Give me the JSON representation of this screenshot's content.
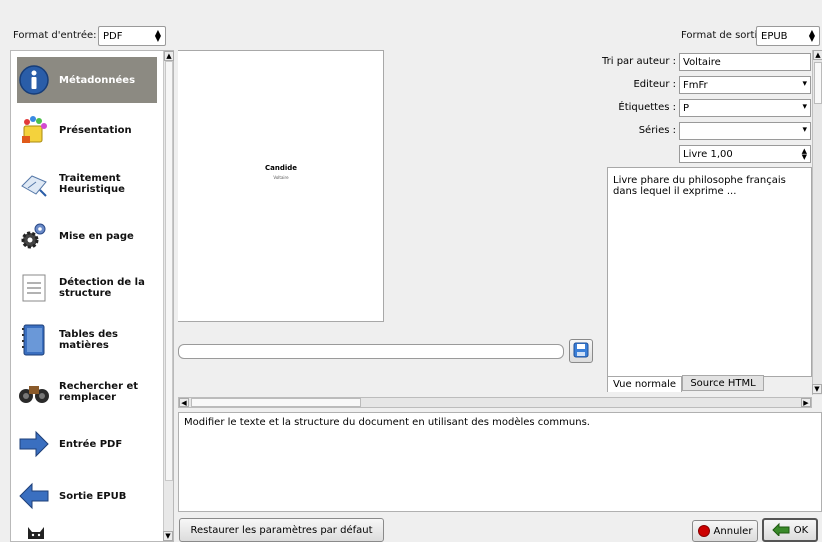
{
  "input_format": {
    "label": "Format d'entrée:",
    "value": "PDF"
  },
  "output_format": {
    "label": "Format de sortie:",
    "value": "EPUB"
  },
  "sidebar": {
    "items": [
      {
        "label": "Métadonnées",
        "icon": "info-icon",
        "selected": true
      },
      {
        "label": "Présentation",
        "icon": "palette-icon"
      },
      {
        "label": "Traitement Heuristique",
        "icon": "heuristics-icon"
      },
      {
        "label": "Mise en page",
        "icon": "gears-icon"
      },
      {
        "label": "Détection de la structure",
        "icon": "document-structure-icon"
      },
      {
        "label": "Tables des matières",
        "icon": "toc-book-icon"
      },
      {
        "label": "Rechercher et remplacer",
        "icon": "binoculars-icon"
      },
      {
        "label": "Entrée PDF",
        "icon": "arrow-right-icon"
      },
      {
        "label": "Sortie EPUB",
        "icon": "arrow-left-icon"
      }
    ]
  },
  "preview": {
    "title": "Candide",
    "author": "Voltaire"
  },
  "metadata": {
    "author_sort_label": "Tri par auteur :",
    "author_sort_value": "Voltaire",
    "publisher_label": "Editeur :",
    "publisher_value": "FmFr",
    "tags_label": "Étiquettes :",
    "tags_value": "P",
    "series_label": "Séries :",
    "series_value": "",
    "series_index": "Livre 1,00",
    "comments": "Livre phare du philosophe français dans lequel il exprime ..."
  },
  "comment_tabs": {
    "normal": "Vue normale",
    "html": "Source HTML"
  },
  "description": "Modifier le texte et la structure du document en utilisant des modèles communs.",
  "buttons": {
    "restore": "Restaurer les paramètres par défaut",
    "cancel": "Annuler",
    "ok": "OK"
  },
  "colors": {
    "selected_item": "#8c8a82",
    "accent_red": "#cc0000"
  }
}
